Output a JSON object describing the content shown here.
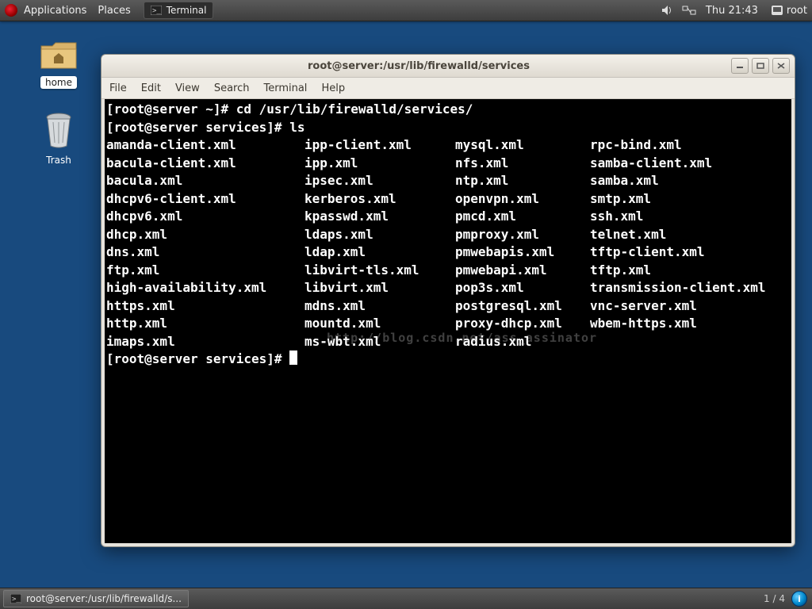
{
  "top_panel": {
    "applications": "Applications",
    "places": "Places",
    "task_label": "Terminal",
    "clock": "Thu 21:43",
    "user": "root"
  },
  "desktop_icons": {
    "home": "home",
    "trash": "Trash"
  },
  "window": {
    "title": "root@server:/usr/lib/firewalld/services",
    "menu": {
      "file": "File",
      "edit": "Edit",
      "view": "View",
      "search": "Search",
      "terminal": "Terminal",
      "help": "Help"
    }
  },
  "terminal": {
    "line1": "[root@server ~]# cd /usr/lib/firewalld/services/",
    "line2": "[root@server services]# ls",
    "cols": {
      "c0": [
        "amanda-client.xml",
        "bacula-client.xml",
        "bacula.xml",
        "dhcpv6-client.xml",
        "dhcpv6.xml",
        "dhcp.xml",
        "dns.xml",
        "ftp.xml",
        "high-availability.xml",
        "https.xml",
        "http.xml",
        "imaps.xml"
      ],
      "c1": [
        "ipp-client.xml",
        "ipp.xml",
        "ipsec.xml",
        "kerberos.xml",
        "kpasswd.xml",
        "ldaps.xml",
        "ldap.xml",
        "libvirt-tls.xml",
        "libvirt.xml",
        "mdns.xml",
        "mountd.xml",
        "ms-wbt.xml"
      ],
      "c2": [
        "mysql.xml",
        "nfs.xml",
        "ntp.xml",
        "openvpn.xml",
        "pmcd.xml",
        "pmproxy.xml",
        "pmwebapis.xml",
        "pmwebapi.xml",
        "pop3s.xml",
        "postgresql.xml",
        "proxy-dhcp.xml",
        "radius.xml"
      ],
      "c3": [
        "rpc-bind.xml",
        "samba-client.xml",
        "samba.xml",
        "smtp.xml",
        "ssh.xml",
        "telnet.xml",
        "tftp-client.xml",
        "tftp.xml",
        "transmission-client.xml",
        "vnc-server.xml",
        "wbem-https.xml",
        ""
      ]
    },
    "prompt3": "[root@server services]# ",
    "watermark": "http://blog.csdn.net/ass_assinator"
  },
  "bottom_panel": {
    "task": "root@server:/usr/lib/firewalld/s...",
    "workspace": "1 / 4"
  }
}
